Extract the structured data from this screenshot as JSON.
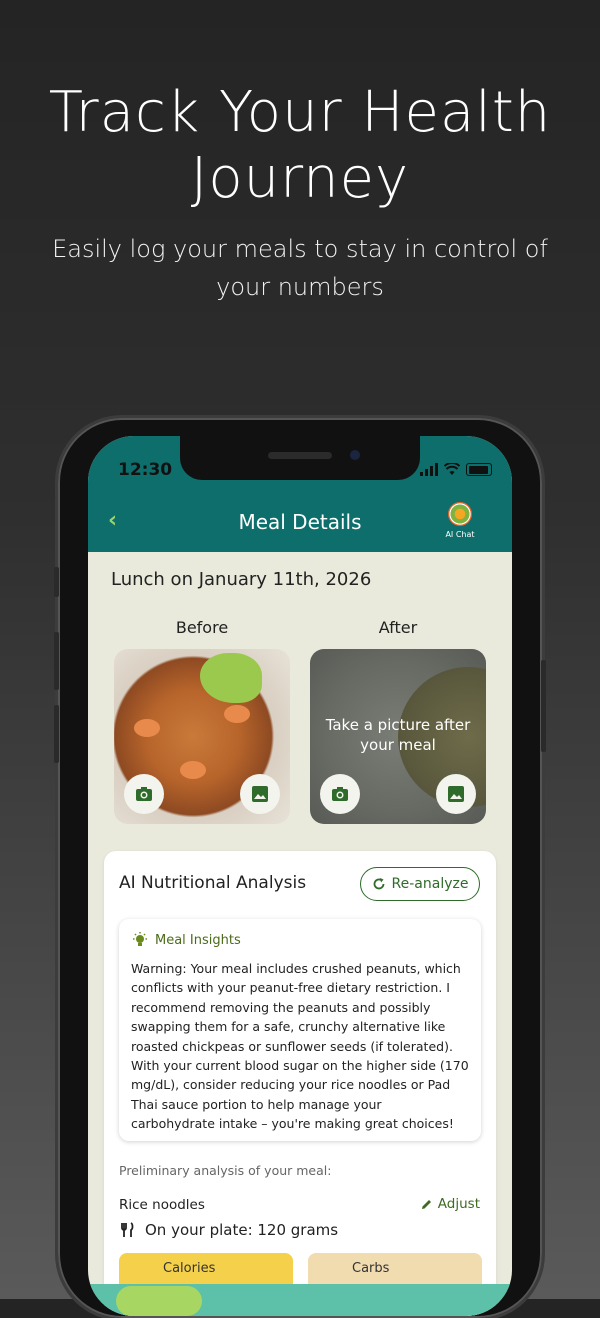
{
  "hero": {
    "title": "Track Your Health Journey",
    "subtitle": "Easily log your meals to stay in control of your numbers"
  },
  "status_bar": {
    "time": "12:30"
  },
  "header": {
    "title": "Meal Details",
    "ai_chat_label": "AI Chat"
  },
  "meal": {
    "date_title": "Lunch on January 11th, 2026",
    "before_label": "Before",
    "after_label": "After",
    "after_placeholder": "Take a picture after your meal"
  },
  "analysis": {
    "title": "AI Nutritional Analysis",
    "reanalyze_label": "Re-analyze",
    "insights_title": "Meal Insights",
    "insights_text": "Warning: Your meal includes crushed peanuts, which conflicts with your peanut-free dietary restriction. I recommend removing the peanuts and possibly swapping them for a safe, crunchy alternative like roasted chickpeas or sunflower seeds (if tolerated). With your current blood sugar on the higher side (170 mg/dL), consider reducing your rice noodles or Pad Thai sauce portion to help manage your carbohydrate intake – you're making great choices!",
    "preliminary_label": "Preliminary analysis of your meal:",
    "item_name": "Rice noodles",
    "adjust_label": "Adjust",
    "plate_text": "On your plate: 120 grams",
    "calories_label": "Calories",
    "carbs_label": "Carbs"
  },
  "colors": {
    "header_bg": "#0e6e6b",
    "screen_bg": "#e9eadc",
    "accent_green": "#2f6b2a",
    "calories_chip": "#f5d04a",
    "carbs_chip": "#f1dcb0",
    "tabbar": "#5dc0a8"
  },
  "icons": [
    "back-chevron-icon",
    "ai-chat-logo-icon",
    "camera-icon",
    "gallery-icon",
    "refresh-icon",
    "lightbulb-icon",
    "pencil-icon",
    "fork-knife-icon"
  ]
}
